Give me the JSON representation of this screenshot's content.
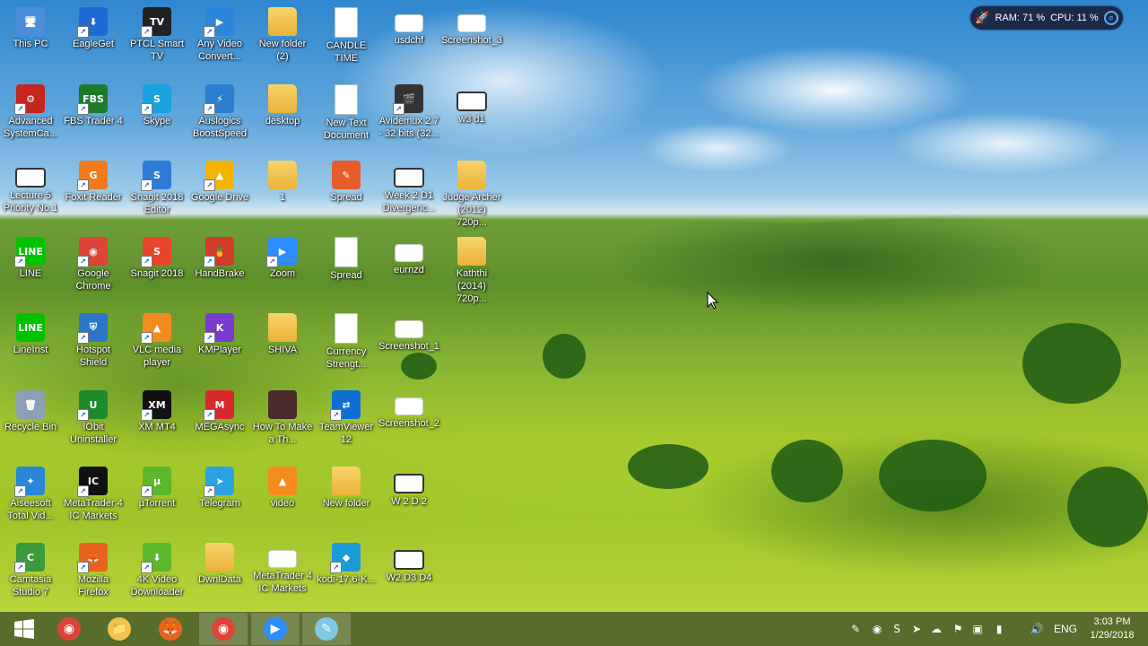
{
  "desktop": {
    "icons": [
      {
        "label": "This PC",
        "glyph": "🖥",
        "color": "#4a8fd8",
        "type": "app",
        "shortcut": false
      },
      {
        "label": "EagleGet",
        "glyph": "⬇",
        "color": "#1e6bd6",
        "type": "app",
        "shortcut": true
      },
      {
        "label": "PTCL Smart TV",
        "glyph": "TV",
        "color": "#222",
        "type": "app",
        "shortcut": true
      },
      {
        "label": "Any Video Convert...",
        "glyph": "▶",
        "color": "#2a86d9",
        "type": "app",
        "shortcut": true
      },
      {
        "label": "New folder (2)",
        "glyph": "",
        "color": "#f0c350",
        "type": "folder",
        "shortcut": false
      },
      {
        "label": "CANDLE TIME",
        "glyph": "",
        "color": "#fff",
        "type": "doc",
        "shortcut": false
      },
      {
        "label": "usdchf",
        "glyph": "",
        "color": "#fff",
        "type": "shot",
        "shortcut": false
      },
      {
        "label": "Screenshot_3",
        "glyph": "",
        "color": "#fff",
        "type": "shot",
        "shortcut": false
      },
      {
        "label": "Advanced SystemCa...",
        "glyph": "⚙",
        "color": "#c3261d",
        "type": "app",
        "shortcut": true
      },
      {
        "label": "FBS Trader 4",
        "glyph": "FBS",
        "color": "#1d7a2b",
        "type": "app",
        "shortcut": true
      },
      {
        "label": "Skype",
        "glyph": "S",
        "color": "#1aa1e0",
        "type": "app",
        "shortcut": true
      },
      {
        "label": "Auslogics BoostSpeed",
        "glyph": "⚡",
        "color": "#2b7fd1",
        "type": "app",
        "shortcut": true
      },
      {
        "label": "desktop",
        "glyph": "",
        "color": "#f0c350",
        "type": "folder",
        "shortcut": false
      },
      {
        "label": "New Text Document",
        "glyph": "",
        "color": "#fff",
        "type": "doc",
        "shortcut": false
      },
      {
        "label": "Avidemux 2.7 - 32 bits (32...",
        "glyph": "🎬",
        "color": "#333",
        "type": "app",
        "shortcut": true
      },
      {
        "label": "w3 d1",
        "glyph": "",
        "color": "#fff",
        "type": "vid",
        "shortcut": false
      },
      {
        "label": "Lecture 5 Priority No.1",
        "glyph": "",
        "color": "#fff",
        "type": "vid",
        "shortcut": false
      },
      {
        "label": "Foxit Reader",
        "glyph": "G",
        "color": "#f27a1c",
        "type": "app",
        "shortcut": true
      },
      {
        "label": "Snagit 2018 Editor",
        "glyph": "S",
        "color": "#2f7bd8",
        "type": "app",
        "shortcut": true
      },
      {
        "label": "Google Drive",
        "glyph": "▲",
        "color": "#f4b400",
        "type": "app",
        "shortcut": true
      },
      {
        "label": "1",
        "glyph": "",
        "color": "#f0c350",
        "type": "folder",
        "shortcut": false
      },
      {
        "label": "Spread",
        "glyph": "✎",
        "color": "#e85b2a",
        "type": "app",
        "shortcut": false
      },
      {
        "label": "Week 2 D1 Divergenc...",
        "glyph": "",
        "color": "#fff",
        "type": "vid",
        "shortcut": false
      },
      {
        "label": "Judge Archer (2012) 720p...",
        "glyph": "",
        "color": "#f0c350",
        "type": "folder",
        "shortcut": false
      },
      {
        "label": "LINE",
        "glyph": "LINE",
        "color": "#00c300",
        "type": "app",
        "shortcut": true
      },
      {
        "label": "Google Chrome",
        "glyph": "◉",
        "color": "#db4437",
        "type": "app",
        "shortcut": true
      },
      {
        "label": "Snagit 2018",
        "glyph": "S",
        "color": "#e8452c",
        "type": "app",
        "shortcut": true
      },
      {
        "label": "HandBrake",
        "glyph": "🍍",
        "color": "#d23b2b",
        "type": "app",
        "shortcut": true
      },
      {
        "label": "Zoom",
        "glyph": "▶",
        "color": "#2d8cff",
        "type": "app",
        "shortcut": true
      },
      {
        "label": "Spread",
        "glyph": "",
        "color": "#fff",
        "type": "doc",
        "shortcut": false
      },
      {
        "label": "eurnzd",
        "glyph": "",
        "color": "#fff",
        "type": "shot",
        "shortcut": false
      },
      {
        "label": "Kaththi (2014) 720p...",
        "glyph": "",
        "color": "#f0c350",
        "type": "folder",
        "shortcut": false
      },
      {
        "label": "LineInst",
        "glyph": "LINE",
        "color": "#00c300",
        "type": "app",
        "shortcut": false
      },
      {
        "label": "Hotspot Shield",
        "glyph": "⛨",
        "color": "#2a76c9",
        "type": "app",
        "shortcut": true
      },
      {
        "label": "VLC media player",
        "glyph": "▲",
        "color": "#f28c1e",
        "type": "app",
        "shortcut": true
      },
      {
        "label": "KMPlayer",
        "glyph": "K",
        "color": "#7a3bd1",
        "type": "app",
        "shortcut": true
      },
      {
        "label": "SHIVA",
        "glyph": "",
        "color": "#f0c350",
        "type": "folder",
        "shortcut": false
      },
      {
        "label": "Currency Strengt...",
        "glyph": "",
        "color": "#fff",
        "type": "doc",
        "shortcut": false
      },
      {
        "label": "Screenshot_1",
        "glyph": "",
        "color": "#fff",
        "type": "shot",
        "shortcut": false
      },
      {
        "label": "Recycle Bin",
        "glyph": "🗑",
        "color": "#8aa0b3",
        "type": "app",
        "shortcut": false
      },
      {
        "label": "IObit Uninstaller",
        "glyph": "U",
        "color": "#1e8a2e",
        "type": "app",
        "shortcut": true
      },
      {
        "label": "XM MT4",
        "glyph": "XM",
        "color": "#111",
        "type": "app",
        "shortcut": true
      },
      {
        "label": "MEGAsync",
        "glyph": "M",
        "color": "#d9272e",
        "type": "app",
        "shortcut": true
      },
      {
        "label": "How To Make a Th...",
        "glyph": "",
        "color": "#4a2a2a",
        "type": "app",
        "shortcut": false
      },
      {
        "label": "TeamViewer 12",
        "glyph": "⇄",
        "color": "#0e6fd1",
        "type": "app",
        "shortcut": true
      },
      {
        "label": "Screenshot_2",
        "glyph": "",
        "color": "#fff",
        "type": "shot",
        "shortcut": false
      },
      {
        "label": "Aiseesoft Total Vid...",
        "glyph": "✦",
        "color": "#2a86d9",
        "type": "app",
        "shortcut": true
      },
      {
        "label": "MetaTrader 4 IC Markets",
        "glyph": "IC",
        "color": "#111",
        "type": "app",
        "shortcut": true
      },
      {
        "label": "µTorrent",
        "glyph": "µ",
        "color": "#5cb82a",
        "type": "app",
        "shortcut": true
      },
      {
        "label": "Telegram",
        "glyph": "➤",
        "color": "#2aa3e0",
        "type": "app",
        "shortcut": true
      },
      {
        "label": "video",
        "glyph": "▲",
        "color": "#f28c1e",
        "type": "app",
        "shortcut": false
      },
      {
        "label": "New folder",
        "glyph": "",
        "color": "#f0c350",
        "type": "folder",
        "shortcut": false
      },
      {
        "label": "W 2 D 2",
        "glyph": "",
        "color": "#fff",
        "type": "vid",
        "shortcut": false
      },
      {
        "label": "Camtasia Studio 7",
        "glyph": "C",
        "color": "#3b9a3b",
        "type": "app",
        "shortcut": true
      },
      {
        "label": "Mozilla Firefox",
        "glyph": "🦊",
        "color": "#e8641e",
        "type": "app",
        "shortcut": true
      },
      {
        "label": "4K Video Downloader",
        "glyph": "⬇",
        "color": "#5cb82a",
        "type": "app",
        "shortcut": true
      },
      {
        "label": "DwnlData",
        "glyph": "",
        "color": "#f0c350",
        "type": "folder",
        "shortcut": false
      },
      {
        "label": "MetaTrader 4 IC Markets",
        "glyph": "",
        "color": "#fff",
        "type": "shot",
        "shortcut": false
      },
      {
        "label": "kodi-17.6-K...",
        "glyph": "◆",
        "color": "#1c9ad6",
        "type": "app",
        "shortcut": true
      },
      {
        "label": "W2 D3 D4",
        "glyph": "",
        "color": "#fff",
        "type": "vid",
        "shortcut": false
      }
    ]
  },
  "sysmon": {
    "ram_label": "RAM: 71 %",
    "cpu_label": "CPU: 11 %"
  },
  "taskbar": {
    "start_icon": "windows-icon",
    "pinned": [
      {
        "name": "chrome",
        "glyph": "◉",
        "color": "#db4437",
        "active": false
      },
      {
        "name": "file-explorer",
        "glyph": "📁",
        "color": "#f0c350",
        "active": false
      },
      {
        "name": "firefox",
        "glyph": "🦊",
        "color": "#e8641e",
        "active": false
      },
      {
        "name": "chrome-2",
        "glyph": "◉",
        "color": "#db4437",
        "active": true
      },
      {
        "name": "zoom",
        "glyph": "▶",
        "color": "#2d8cff",
        "active": true
      },
      {
        "name": "notepad",
        "glyph": "✎",
        "color": "#7ec8e3",
        "active": true
      }
    ],
    "tray_icons": [
      "pen-icon",
      "zoom-icon",
      "skype-icon",
      "telegram-icon",
      "onedrive-icon",
      "flag-icon",
      "network-icon",
      "battery-icon",
      "volume-icon"
    ],
    "language": "ENG",
    "time": "3:03 PM",
    "date": "1/29/2018"
  }
}
